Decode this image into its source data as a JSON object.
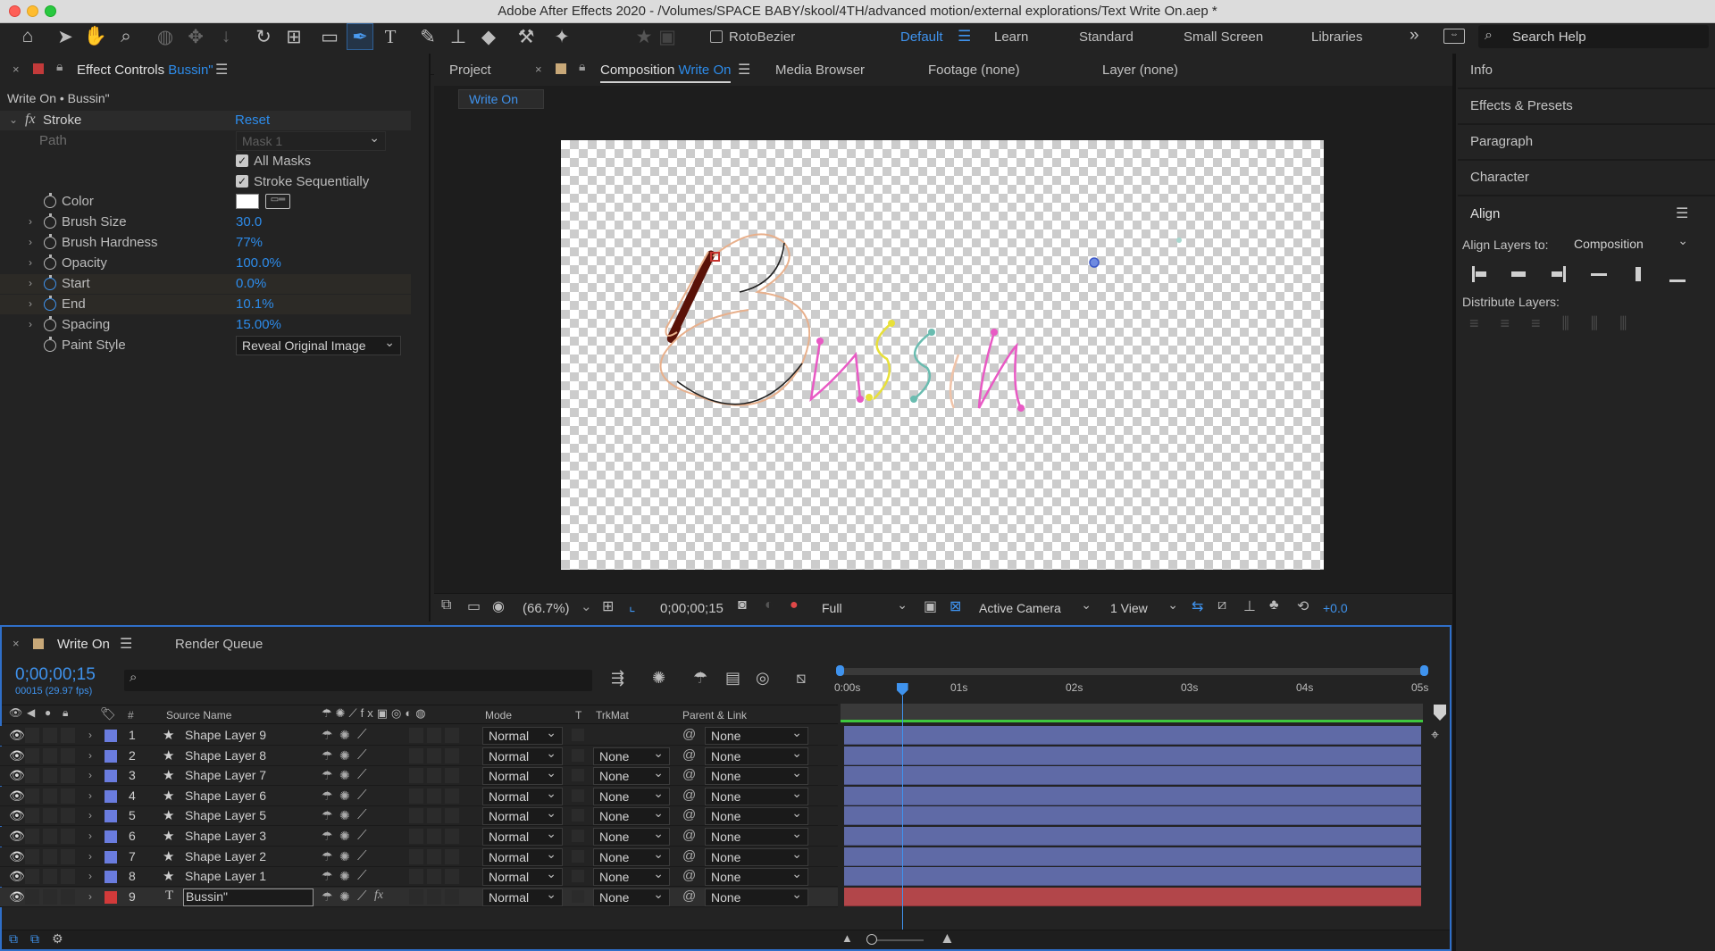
{
  "window": {
    "title": "Adobe After Effects 2020 - /Volumes/SPACE BABY/skool/4TH/advanced motion/external explorations/Text Write On.aep *"
  },
  "toolbar": {
    "rotobezier_label": "RotoBezier",
    "workspaces": [
      "Default",
      "Learn",
      "Standard",
      "Small Screen",
      "Libraries"
    ],
    "active_workspace": "Default",
    "more": "»",
    "search_help_placeholder": "Search Help"
  },
  "effect_controls": {
    "tab_prefix": "Effect Controls",
    "tab_layer": "Bussin\"",
    "breadcrumb": "Write On • Bussin\"",
    "effect_name": "Stroke",
    "reset": "Reset",
    "fx": "fx",
    "path_label": "Path",
    "path_value": "Mask 1",
    "all_masks": "All Masks",
    "stroke_sequentially": "Stroke Sequentially",
    "props": [
      {
        "label": "Color",
        "value": ""
      },
      {
        "label": "Brush Size",
        "value": "30.0"
      },
      {
        "label": "Brush Hardness",
        "value": "77%"
      },
      {
        "label": "Opacity",
        "value": "100.0%"
      },
      {
        "label": "Start",
        "value": "0.0%"
      },
      {
        "label": "End",
        "value": "10.1%"
      },
      {
        "label": "Spacing",
        "value": "15.00%"
      },
      {
        "label": "Paint Style",
        "value": "Reveal Original Image"
      }
    ]
  },
  "viewer": {
    "tabs": [
      "Project",
      "Composition",
      "Media Browser",
      "Footage (none)",
      "Layer (none)"
    ],
    "comp_name": "Write On",
    "subtab": "Write On",
    "zoom": "(66.7%)",
    "timecode": "0;00;00;15",
    "resolution": "Full",
    "camera": "Active Camera",
    "views": "1 View",
    "exposure": "+0.0"
  },
  "right_panel": {
    "items": [
      "Info",
      "Effects & Presets",
      "Paragraph",
      "Character"
    ],
    "align_title": "Align",
    "align_layers_to_label": "Align Layers to:",
    "align_layers_to_value": "Composition",
    "distribute_label": "Distribute Layers:"
  },
  "timeline": {
    "tab": "Write On",
    "render_queue": "Render Queue",
    "timecode": "0;00;00;15",
    "frame_info": "00015 (29.97 fps)",
    "columns": {
      "num": "#",
      "source": "Source Name",
      "mode": "Mode",
      "t": "T",
      "trkmat": "TrkMat",
      "parent": "Parent & Link"
    },
    "ruler": [
      "0:00s",
      "01s",
      "02s",
      "03s",
      "04s",
      "05s"
    ],
    "playhead_fraction": 0.1,
    "layers": [
      {
        "num": "1",
        "name": "Shape Layer 9",
        "mode": "Normal",
        "trkmat": "",
        "parent": "None",
        "color": "#6a7cde",
        "type": "shape"
      },
      {
        "num": "2",
        "name": "Shape Layer 8",
        "mode": "Normal",
        "trkmat": "None",
        "parent": "None",
        "color": "#6a7cde",
        "type": "shape"
      },
      {
        "num": "3",
        "name": "Shape Layer 7",
        "mode": "Normal",
        "trkmat": "None",
        "parent": "None",
        "color": "#6a7cde",
        "type": "shape"
      },
      {
        "num": "4",
        "name": "Shape Layer 6",
        "mode": "Normal",
        "trkmat": "None",
        "parent": "None",
        "color": "#6a7cde",
        "type": "shape"
      },
      {
        "num": "5",
        "name": "Shape Layer 5",
        "mode": "Normal",
        "trkmat": "None",
        "parent": "None",
        "color": "#6a7cde",
        "type": "shape"
      },
      {
        "num": "6",
        "name": "Shape Layer 3",
        "mode": "Normal",
        "trkmat": "None",
        "parent": "None",
        "color": "#6a7cde",
        "type": "shape"
      },
      {
        "num": "7",
        "name": "Shape Layer 2",
        "mode": "Normal",
        "trkmat": "None",
        "parent": "None",
        "color": "#6a7cde",
        "type": "shape"
      },
      {
        "num": "8",
        "name": "Shape Layer 1",
        "mode": "Normal",
        "trkmat": "None",
        "parent": "None",
        "color": "#6a7cde",
        "type": "shape"
      },
      {
        "num": "9",
        "name": "Bussin\"",
        "mode": "Normal",
        "trkmat": "None",
        "parent": "None",
        "color": "#d23a3a",
        "type": "text"
      }
    ]
  },
  "colors": {
    "accent": "#2d8ceb",
    "layer_bar": "#5f6aa6",
    "text_bar": "#b2464a",
    "work_area": "#3ec83e"
  }
}
